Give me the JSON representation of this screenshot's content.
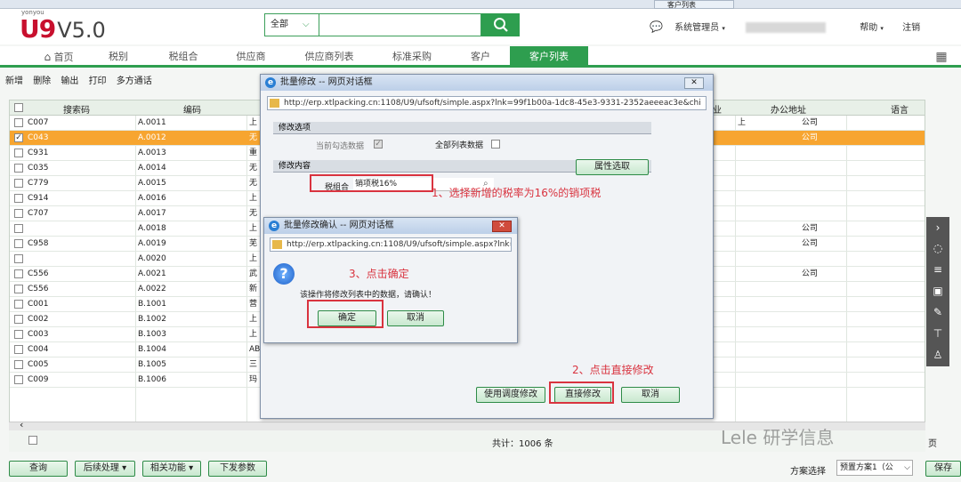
{
  "browser": {
    "tab_label": "客户列表"
  },
  "header": {
    "logo_sub": "yonyou",
    "logo_main": "U9",
    "logo_version": "V5.0",
    "search_scope": "全部",
    "search_placeholder": "",
    "user_role": "系统管理员",
    "help": "帮助",
    "logout": "注销"
  },
  "nav": {
    "items": [
      "首页",
      "税别",
      "税组合",
      "供应商",
      "供应商列表",
      "标准采购",
      "客户",
      "客户列表"
    ]
  },
  "toolbar": {
    "items": [
      "新增",
      "删除",
      "输出",
      "打印",
      "多方通话"
    ]
  },
  "grid": {
    "headers": {
      "search_code": "搜索码",
      "code": "编码",
      "industry": "业",
      "office_address": "办公地址",
      "language": "语言"
    },
    "rows": [
      {
        "search": "C007",
        "code": "A.0011",
        "name": "上",
        "addr": "上　　　　　　　公司",
        "checked": false,
        "selected": false
      },
      {
        "search": "C043",
        "code": "A.0012",
        "name": "无",
        "addr": "　　　　　　　　公司",
        "checked": true,
        "selected": true
      },
      {
        "search": "C931",
        "code": "A.0013",
        "name": "重",
        "addr": "",
        "checked": false,
        "selected": false
      },
      {
        "search": "C035",
        "code": "A.0014",
        "name": "无",
        "addr": "",
        "checked": false,
        "selected": false
      },
      {
        "search": "C779",
        "code": "A.0015",
        "name": "无",
        "addr": "",
        "checked": false,
        "selected": false
      },
      {
        "search": "C914",
        "code": "A.0016",
        "name": "上",
        "addr": "",
        "checked": false,
        "selected": false
      },
      {
        "search": "C707",
        "code": "A.0017",
        "name": "无",
        "addr": "",
        "checked": false,
        "selected": false
      },
      {
        "search": "",
        "code": "A.0018",
        "name": "上",
        "addr": "　　　　　　　　公司",
        "checked": false,
        "selected": false
      },
      {
        "search": "C958",
        "code": "A.0019",
        "name": "芜",
        "addr": "　　　　　　　　公司",
        "checked": false,
        "selected": false
      },
      {
        "search": "",
        "code": "A.0020",
        "name": "上",
        "addr": "",
        "checked": false,
        "selected": false
      },
      {
        "search": "C556",
        "code": "A.0021",
        "name": "武",
        "addr": "　　　　　　　　公司",
        "checked": false,
        "selected": false
      },
      {
        "search": "C556",
        "code": "A.0022",
        "name": "新",
        "addr": "",
        "checked": false,
        "selected": false
      },
      {
        "search": "C001",
        "code": "B.1001",
        "name": "营",
        "addr": "",
        "checked": false,
        "selected": false
      },
      {
        "search": "C002",
        "code": "B.1002",
        "name": "上",
        "addr": "",
        "checked": false,
        "selected": false
      },
      {
        "search": "C003",
        "code": "B.1003",
        "name": "上",
        "addr": "",
        "checked": false,
        "selected": false
      },
      {
        "search": "C004",
        "code": "B.1004",
        "name": "AB",
        "addr": "",
        "checked": false,
        "selected": false
      },
      {
        "search": "C005",
        "code": "B.1005",
        "name": "三",
        "addr": "",
        "checked": false,
        "selected": false
      },
      {
        "search": "C009",
        "code": "B.1006",
        "name": "玛",
        "addr": "",
        "checked": false,
        "selected": false
      }
    ],
    "total": "共计：1006 条",
    "page_suffix": "页"
  },
  "bottom": {
    "query": "查询",
    "follow_up": "后续处理",
    "related": "相关功能",
    "send_params": "下发参数",
    "plan_label": "方案选择",
    "plan_value": "预置方案1（公",
    "save": "保存"
  },
  "dialog_batch": {
    "title": "批量修改 -- 网页对话框",
    "url": "http://erp.xtlpacking.cn:1108/U9/ufsoft/simple.aspx?lnk=99f1b00a-1dc8-45e3-9331-2352aeeeac3e&chi",
    "section_options": "修改选项",
    "current_checked": "当前勾选数据",
    "all_list": "全部列表数据",
    "section_content": "修改内容",
    "attr_select": "属性选取",
    "field_label": "税组合",
    "field_value": "销项税16%",
    "btn_schedule": "使用调度修改",
    "btn_direct": "直接修改",
    "btn_cancel": "取消"
  },
  "dialog_confirm": {
    "title": "批量修改确认 -- 网页对话框",
    "url": "http://erp.xtlpacking.cn:1108/U9/ufsoft/simple.aspx?lnk=",
    "message": "该操作将修改列表中的数据，请确认！",
    "ok": "确定",
    "cancel": "取消"
  },
  "annotations": {
    "step1": "1、选择新增的税率为16%的销项税",
    "step2": "2、点击直接修改",
    "step3": "3、点击确定"
  },
  "watermark": "Lele 研学信息"
}
